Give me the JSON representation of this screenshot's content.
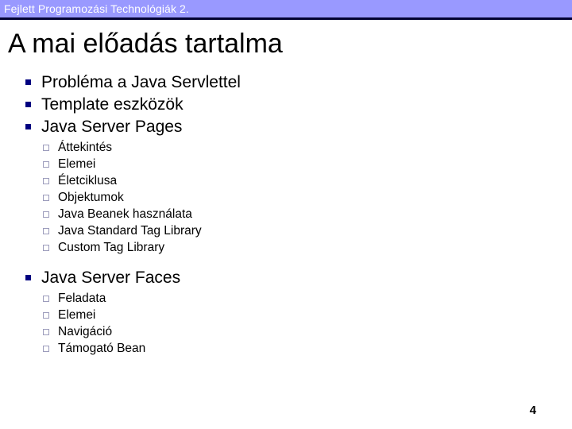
{
  "header": {
    "text": "Fejlett Programozási Technológiák 2.",
    "background_color": "#9999FF",
    "text_color": "#FFFFFF",
    "rule_color": "#000033"
  },
  "title": "A mai előadás tartalma",
  "bullet_markers": {
    "level1": "filled-square-icon",
    "level1_color": "#000080",
    "level2": "hollow-square-icon",
    "level2_color": "#9C9CBC"
  },
  "outline": {
    "items": [
      {
        "label": "Probléma a Java Servlettel",
        "children": []
      },
      {
        "label": "Template eszközök",
        "children": []
      },
      {
        "label": "Java Server Pages",
        "children": [
          {
            "label": "Áttekintés"
          },
          {
            "label": "Elemei"
          },
          {
            "label": "Életciklusa"
          },
          {
            "label": "Objektumok"
          },
          {
            "label": "Java Beanek használata"
          },
          {
            "label": "Java Standard Tag Library"
          },
          {
            "label": "Custom Tag Library"
          }
        ]
      },
      {
        "label": "Java Server Faces",
        "children": [
          {
            "label": "Feladata"
          },
          {
            "label": "Elemei"
          },
          {
            "label": "Navigáció"
          },
          {
            "label": "Támogató Bean"
          }
        ]
      }
    ]
  },
  "footer": {
    "page_number": "4"
  }
}
